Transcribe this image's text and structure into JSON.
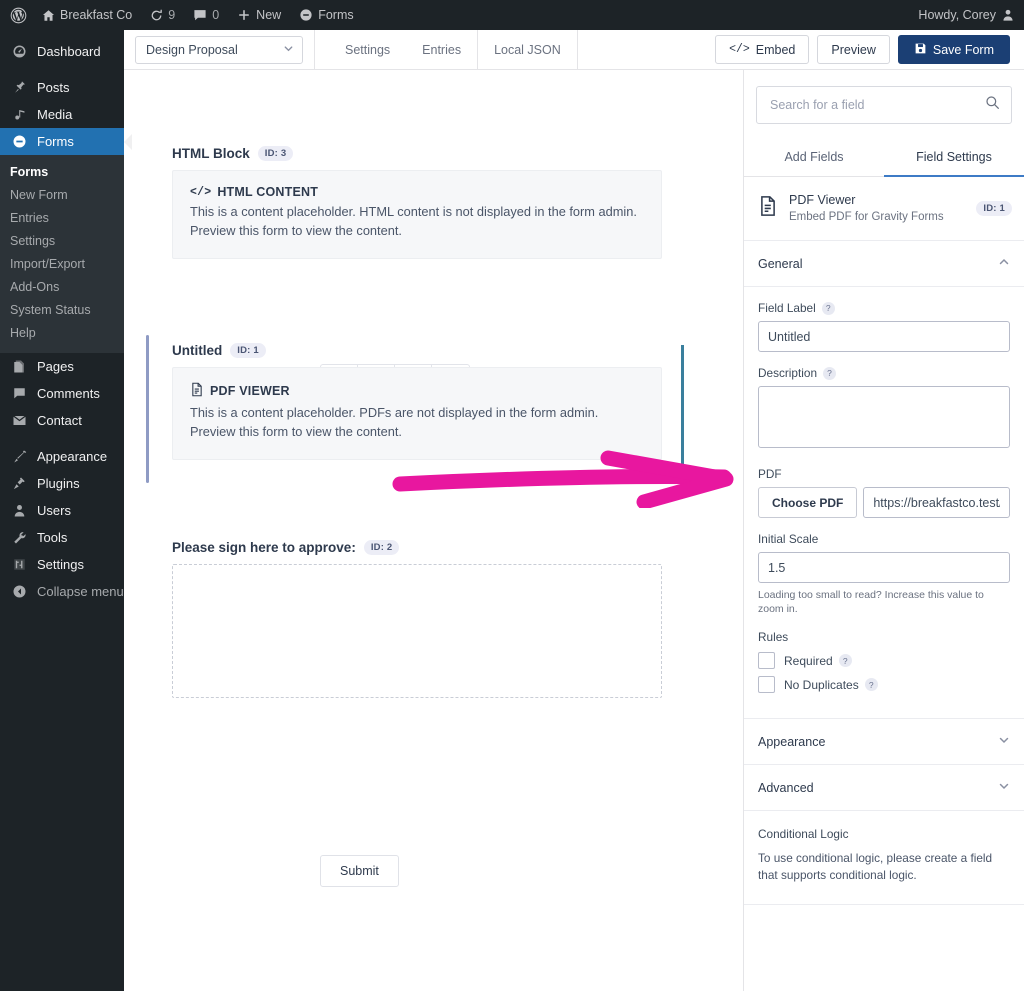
{
  "adminbar": {
    "site_name": "Breakfast Co",
    "updates_count": "9",
    "comments_count": "0",
    "new_label": "New",
    "forms_label": "Forms",
    "howdy": "Howdy, Corey"
  },
  "sidebar": {
    "items": [
      {
        "label": "Dashboard",
        "icon": "dashboard-icon"
      },
      {
        "label": "Posts",
        "icon": "pin-icon"
      },
      {
        "label": "Media",
        "icon": "media-icon"
      },
      {
        "label": "Forms",
        "icon": "forms-icon"
      },
      {
        "label": "Pages",
        "icon": "pages-icon"
      },
      {
        "label": "Comments",
        "icon": "comments-icon"
      },
      {
        "label": "Contact",
        "icon": "mail-icon"
      },
      {
        "label": "Appearance",
        "icon": "brush-icon"
      },
      {
        "label": "Plugins",
        "icon": "plug-icon"
      },
      {
        "label": "Users",
        "icon": "users-icon"
      },
      {
        "label": "Tools",
        "icon": "wrench-icon"
      },
      {
        "label": "Settings",
        "icon": "settings-icon"
      },
      {
        "label": "Collapse menu",
        "icon": "collapse-icon"
      }
    ],
    "forms_submenu": [
      "Forms",
      "New Form",
      "Entries",
      "Settings",
      "Import/Export",
      "Add-Ons",
      "System Status",
      "Help"
    ]
  },
  "toolbar": {
    "form_name": "Design Proposal",
    "tabs": [
      "Settings",
      "Entries",
      "Local JSON"
    ],
    "embed_label": "Embed",
    "preview_label": "Preview",
    "save_label": "Save Form"
  },
  "canvas": {
    "fields": [
      {
        "title": "HTML Block",
        "id_badge": "ID: 3",
        "placeholder_head": "HTML CONTENT",
        "placeholder_icon": "code-icon",
        "placeholder_body": "This is a content placeholder. HTML content is not displayed in the form admin. Preview this form to view the content."
      },
      {
        "title": "Untitled",
        "id_badge": "ID: 1",
        "placeholder_head": "PDF VIEWER",
        "placeholder_icon": "document-icon",
        "placeholder_body": "This is a content placeholder. PDFs are not displayed in the form admin. Preview this form to view the content."
      },
      {
        "title": "Please sign here to approve:",
        "id_badge": "ID: 2"
      }
    ],
    "field_toolbar": [
      "drag-handle-icon",
      "duplicate-icon",
      "field-settings-icon",
      "delete-icon"
    ],
    "submit_label": "Submit"
  },
  "panel": {
    "search_placeholder": "Search for a field",
    "tabs": [
      {
        "label": "Add Fields",
        "active": false
      },
      {
        "label": "Field Settings",
        "active": true
      }
    ],
    "field_header": {
      "title": "PDF Viewer",
      "subtitle": "Embed PDF for Gravity Forms",
      "id_badge": "ID: 1"
    },
    "general": {
      "section_label": "General",
      "field_label_label": "Field Label",
      "field_label_value": "Untitled",
      "description_label": "Description",
      "description_value": "",
      "pdf_label": "PDF",
      "choose_pdf_label": "Choose PDF",
      "pdf_url_value": "https://breakfastco.test/wp-content/uploads/",
      "initial_scale_label": "Initial Scale",
      "initial_scale_value": "1.5",
      "initial_scale_hint": "Loading too small to read? Increase this value to zoom in.",
      "rules_label": "Rules",
      "required_label": "Required",
      "no_duplicates_label": "No Duplicates"
    },
    "appearance_label": "Appearance",
    "advanced_label": "Advanced",
    "conditional_logic": {
      "title": "Conditional Logic",
      "text": "To use conditional logic, please create a field that supports conditional logic."
    }
  },
  "annotations": {
    "arrow_color": "#e8179f",
    "line_color": "#3a7f9d"
  }
}
